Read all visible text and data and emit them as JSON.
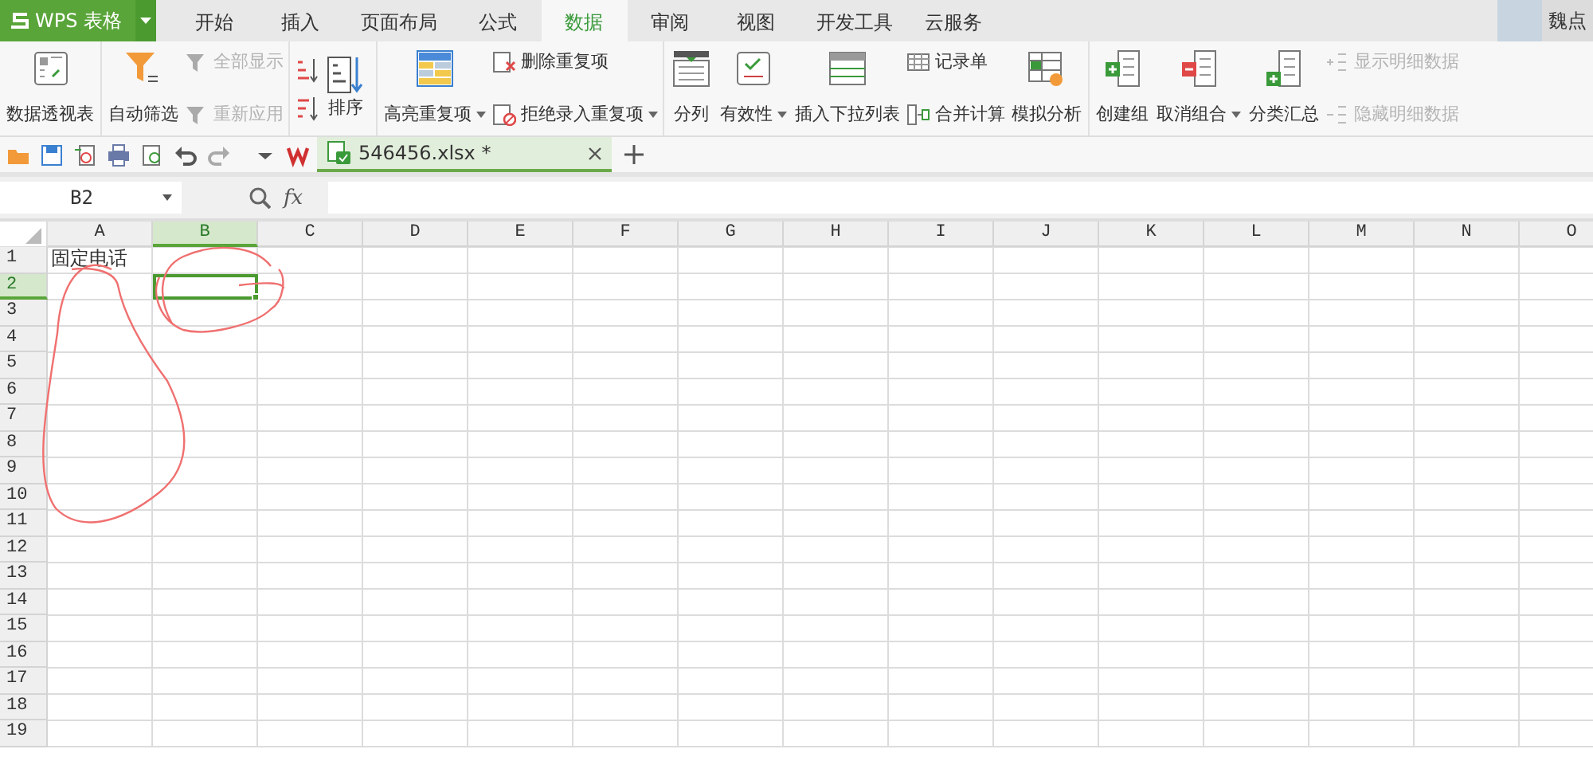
{
  "app_button": {
    "label": "WPS 表格"
  },
  "tabs": [
    {
      "label": "开始",
      "selected": false
    },
    {
      "label": "插入",
      "selected": false
    },
    {
      "label": "页面布局",
      "selected": false
    },
    {
      "label": "公式",
      "selected": false
    },
    {
      "label": "数据",
      "selected": true
    },
    {
      "label": "审阅",
      "selected": false
    },
    {
      "label": "视图",
      "selected": false
    },
    {
      "label": "开发工具",
      "selected": false
    },
    {
      "label": "云服务",
      "selected": false
    }
  ],
  "user": {
    "name": "魏点"
  },
  "ribbon": {
    "groups": [
      {
        "items": [
          {
            "kind": "large",
            "label": "数据透视表",
            "dropdown": false,
            "disabled": false
          }
        ]
      },
      {
        "items": [
          {
            "kind": "large",
            "label": "自动筛选",
            "dropdown": false,
            "disabled": false
          },
          {
            "kind": "stack",
            "items": [
              {
                "label": "全部显示",
                "dropdown": false,
                "disabled": true
              },
              {
                "label": "重新应用",
                "dropdown": false,
                "disabled": true
              }
            ]
          }
        ]
      },
      {
        "items": [
          {
            "kind": "sort",
            "label": "排序",
            "dropdown": false,
            "disabled": false
          }
        ]
      },
      {
        "items": [
          {
            "kind": "large",
            "label": "高亮重复项",
            "dropdown": true,
            "disabled": false
          },
          {
            "kind": "stack",
            "items": [
              {
                "label": "删除重复项",
                "dropdown": false,
                "disabled": false
              },
              {
                "label": "拒绝录入重复项",
                "dropdown": true,
                "disabled": false
              }
            ]
          }
        ]
      },
      {
        "items": [
          {
            "kind": "large",
            "label": "分列",
            "dropdown": false,
            "disabled": false
          },
          {
            "kind": "large",
            "label": "有效性",
            "dropdown": true,
            "disabled": false
          },
          {
            "kind": "large",
            "label": "插入下拉列表",
            "dropdown": false,
            "disabled": false
          },
          {
            "kind": "stack",
            "items": [
              {
                "label": "记录单",
                "dropdown": false,
                "disabled": false
              },
              {
                "label": "合并计算",
                "dropdown": false,
                "disabled": false
              }
            ]
          },
          {
            "kind": "large",
            "label": "模拟分析",
            "dropdown": false,
            "disabled": false
          }
        ]
      },
      {
        "items": [
          {
            "kind": "large",
            "label": "创建组",
            "dropdown": false,
            "disabled": false
          },
          {
            "kind": "large",
            "label": "取消组合",
            "dropdown": true,
            "disabled": false
          },
          {
            "kind": "large",
            "label": "分类汇总",
            "dropdown": false,
            "disabled": false
          },
          {
            "kind": "stack",
            "items": [
              {
                "label": "显示明细数据",
                "dropdown": false,
                "disabled": true
              },
              {
                "label": "隐藏明细数据",
                "dropdown": false,
                "disabled": true
              }
            ]
          }
        ]
      }
    ]
  },
  "documents": [
    {
      "title": "546456.xlsx *",
      "selected": true
    }
  ],
  "formula_bar": {
    "name_box": "B2",
    "fx": "fx"
  },
  "sheet": {
    "columns": [
      {
        "label": "A",
        "selected": false
      },
      {
        "label": "B",
        "selected": true
      },
      {
        "label": "C",
        "selected": false
      },
      {
        "label": "D",
        "selected": false
      },
      {
        "label": "E",
        "selected": false
      },
      {
        "label": "F",
        "selected": false
      },
      {
        "label": "G",
        "selected": false
      },
      {
        "label": "H",
        "selected": false
      },
      {
        "label": "I",
        "selected": false
      },
      {
        "label": "J",
        "selected": false
      },
      {
        "label": "K",
        "selected": false
      },
      {
        "label": "L",
        "selected": false
      },
      {
        "label": "M",
        "selected": false
      },
      {
        "label": "N",
        "selected": false
      },
      {
        "label": "O",
        "selected": false
      }
    ],
    "rows": [
      {
        "label": "1",
        "selected": false,
        "values": [
          "固定电话"
        ]
      },
      {
        "label": "2",
        "selected": true
      },
      {
        "label": "3",
        "selected": false
      },
      {
        "label": "4",
        "selected": false
      },
      {
        "label": "5",
        "selected": false
      },
      {
        "label": "6",
        "selected": false
      },
      {
        "label": "7",
        "selected": false
      },
      {
        "label": "8",
        "selected": false
      },
      {
        "label": "9",
        "selected": false
      },
      {
        "label": "10",
        "selected": false
      },
      {
        "label": "11",
        "selected": false
      },
      {
        "label": "12",
        "selected": false
      },
      {
        "label": "13",
        "selected": false
      },
      {
        "label": "14",
        "selected": false
      },
      {
        "label": "15",
        "selected": false
      },
      {
        "label": "16",
        "selected": false
      },
      {
        "label": "17",
        "selected": false
      },
      {
        "label": "18",
        "selected": false
      },
      {
        "label": "19",
        "selected": false
      }
    ]
  }
}
